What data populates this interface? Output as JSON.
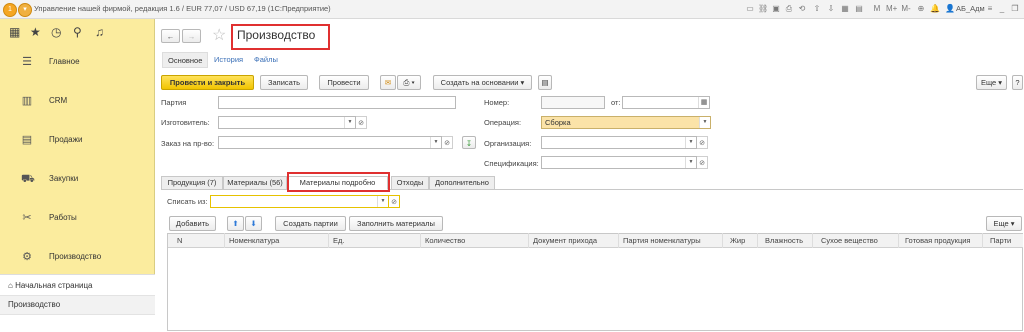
{
  "titlebar": {
    "title": "Управление нашей фирмой, редакция 1.6 / EUR 77,07 / USD 67,19 (1С:Предприятие)",
    "user": "АБ_Адм",
    "m_labels": [
      "M",
      "M+",
      "M-"
    ]
  },
  "sidebar": {
    "items": [
      {
        "label": "Главное",
        "icon": "menu-lines-icon"
      },
      {
        "label": "CRM",
        "icon": "crm-icon"
      },
      {
        "label": "Продажи",
        "icon": "sales-icon"
      },
      {
        "label": "Закупки",
        "icon": "purchases-icon"
      },
      {
        "label": "Работы",
        "icon": "tools-icon"
      },
      {
        "label": "Производство",
        "icon": "production-icon"
      }
    ],
    "home": "Начальная страница",
    "open_page": "Производство"
  },
  "doc": {
    "title": "Производство",
    "subnav": [
      "Основное",
      "История",
      "Файлы"
    ]
  },
  "toolbar": {
    "post_close": "Провести и закрыть",
    "save": "Записать",
    "post": "Провести",
    "create_based": "Создать на основании",
    "more": "Еще",
    "help": "?"
  },
  "form": {
    "batch_label": "Партия",
    "manufacturer_label": "Изготовитель:",
    "order_label": "Заказ на пр-во:",
    "number_label": "Номер:",
    "from_label": "от:",
    "operation_label": "Операция:",
    "operation_value": "Сборка",
    "org_label": "Организация:",
    "spec_label": "Спецификация:"
  },
  "tabs": [
    "Продукция (7)",
    "Материалы (56)",
    "Материалы подробно",
    "Отходы",
    "Дополнительно"
  ],
  "panel": {
    "write_off_label": "Списать из:",
    "add": "Добавить",
    "create_batches": "Создать партии",
    "fill_materials": "Заполнить материалы",
    "more": "Еще"
  },
  "table": {
    "columns": [
      "N",
      "Номенклатура",
      "Ед.",
      "Количество",
      "Документ прихода",
      "Партия номенклатуры",
      "Жир",
      "Влажность",
      "Сухое вещество",
      "Готовая продукция",
      "Парти"
    ]
  },
  "colors": {
    "sidebar": "#fbec9e",
    "primary_button": "#f2c400",
    "operation_highlight": "#fbe3a8",
    "annotation_box": "#e03030"
  }
}
